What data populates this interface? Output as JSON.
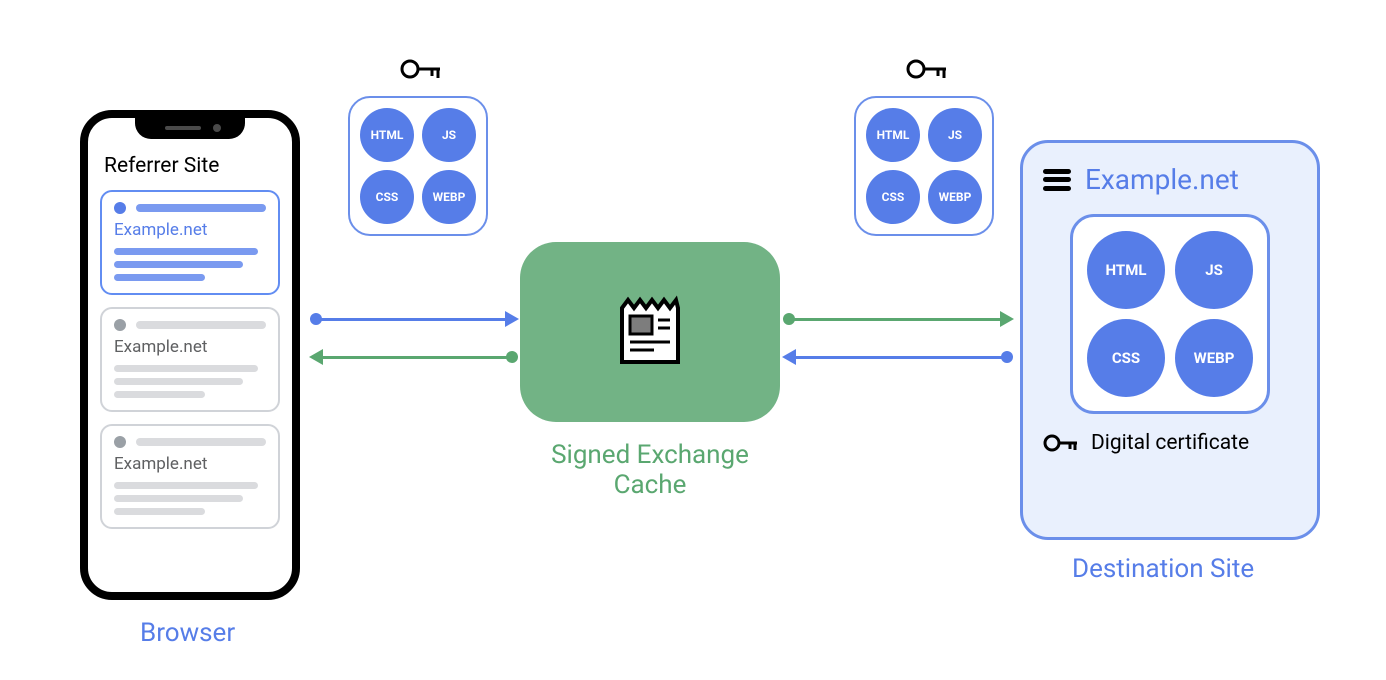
{
  "browser": {
    "phone_title": "Referrer Site",
    "cards": [
      {
        "title": "Example.net",
        "active": true
      },
      {
        "title": "Example.net",
        "active": false
      },
      {
        "title": "Example.net",
        "active": false
      }
    ],
    "label": "Browser"
  },
  "bundles": {
    "resources": [
      "HTML",
      "JS",
      "CSS",
      "WEBP"
    ]
  },
  "cache": {
    "label": "Signed Exchange\nCache"
  },
  "destination": {
    "title": "Example.net",
    "resources": [
      "HTML",
      "JS",
      "CSS",
      "WEBP"
    ],
    "cert_label": "Digital certificate",
    "label": "Destination Site"
  },
  "colors": {
    "blue": "#567de8",
    "green": "#5aa770",
    "cache_bg": "#72b385",
    "dest_bg": "#e9f0fd"
  }
}
